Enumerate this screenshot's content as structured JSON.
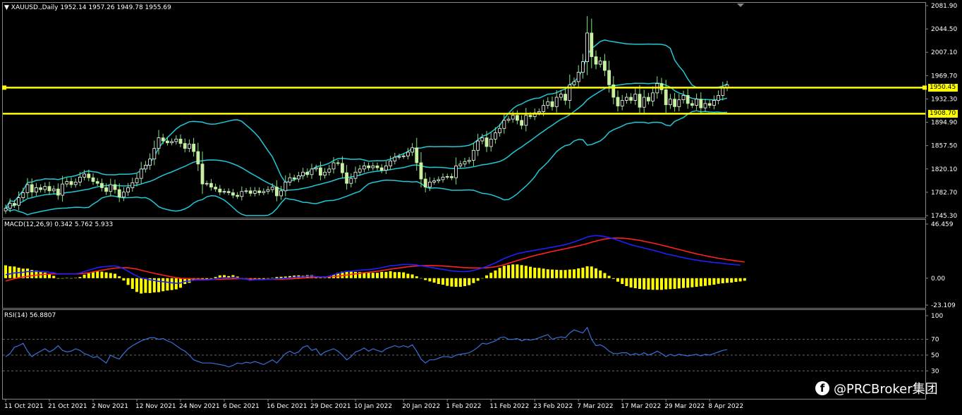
{
  "symbol_header": "XAUUSD.,Daily",
  "ohlc_header": "1952.14 1957.26 1949.78 1955.69",
  "macd_header": "MACD(12,26,9) 0.342 5.762 5.933",
  "rsi_header": "RSI(14) 56.8807",
  "watermark": "@PRCBroker集团",
  "watermark_icon": "facebook-icon",
  "colors": {
    "background": "#000000",
    "bull_candle": "#ffffff",
    "bear_candle": "#c8f0a0",
    "wick": "#7fe87f",
    "bollinger": "#20c8d8",
    "horizontal_levels": "#ffff00",
    "macd_line": "#2020ff",
    "signal_line": "#ff2020",
    "histogram": "#ffff00",
    "rsi_line": "#3a6fd8",
    "grid": "#444444"
  },
  "price_boxes": [
    {
      "label": "1950.45"
    },
    {
      "label": "1908.70"
    }
  ],
  "chart_data": [
    {
      "type": "candlestick",
      "panel": "price",
      "symbol": "XAUUSD.",
      "timeframe": "Daily",
      "ylim": [
        1745.3,
        2081.9
      ],
      "y_ticks": [
        "2081.90",
        "2044.50",
        "2007.10",
        "1969.70",
        "1932.30",
        "1894.90",
        "1857.50",
        "1820.10",
        "1782.70",
        "1745.30"
      ],
      "x_ticks": [
        "11 Oct 2021",
        "21 Oct 2021",
        "2 Nov 2021",
        "12 Nov 2021",
        "24 Nov 2021",
        "6 Dec 2021",
        "16 Dec 2021",
        "29 Dec 2021",
        "10 Jan 2022",
        "20 Jan 2022",
        "1 Feb 2022",
        "11 Feb 2022",
        "23 Feb 2022",
        "7 Mar 2022",
        "17 Mar 2022",
        "29 Mar 2022",
        "8 Apr 2022"
      ],
      "horizontal_levels": [
        1950.45,
        1908.7
      ],
      "close": [
        1757,
        1765,
        1762,
        1774,
        1782,
        1795,
        1783,
        1790,
        1787,
        1792,
        1785,
        1788,
        1778,
        1796,
        1800,
        1795,
        1799,
        1807,
        1812,
        1806,
        1800,
        1797,
        1790,
        1784,
        1795,
        1787,
        1775,
        1783,
        1790,
        1798,
        1805,
        1820,
        1826,
        1836,
        1853,
        1870,
        1865,
        1862,
        1864,
        1868,
        1861,
        1853,
        1860,
        1848,
        1828,
        1796,
        1797,
        1791,
        1788,
        1783,
        1784,
        1782,
        1778,
        1776,
        1784,
        1785,
        1781,
        1785,
        1782,
        1784,
        1787,
        1791,
        1777,
        1785,
        1799,
        1806,
        1804,
        1809,
        1815,
        1811,
        1820,
        1822,
        1810,
        1815,
        1820,
        1830,
        1829,
        1814,
        1797,
        1805,
        1815,
        1820,
        1825,
        1822,
        1825,
        1822,
        1818,
        1825,
        1833,
        1839,
        1840,
        1841,
        1847,
        1854,
        1830,
        1804,
        1791,
        1799,
        1801,
        1803,
        1807,
        1808,
        1806,
        1825,
        1828,
        1832,
        1834,
        1850,
        1865,
        1870,
        1856,
        1868,
        1878,
        1885,
        1898,
        1900,
        1906,
        1898,
        1890,
        1906,
        1904,
        1910,
        1912,
        1922,
        1928,
        1920,
        1935,
        1940,
        1930,
        1955,
        1960,
        1975,
        1992,
        2038,
        2000,
        1988,
        1993,
        1978,
        1955,
        1935,
        1921,
        1930,
        1935,
        1930,
        1940,
        1919,
        1935,
        1929,
        1942,
        1957,
        1947,
        1923,
        1932,
        1920,
        1931,
        1938,
        1925,
        1922,
        1932,
        1918,
        1925,
        1922,
        1930,
        1938,
        1950,
        1955
      ]
    },
    {
      "type": "line+bar",
      "panel": "macd",
      "title": "MACD(12,26,9)",
      "values_header": [
        0.342,
        5.762,
        5.933
      ],
      "ylim": [
        -23.109,
        46.459
      ],
      "y_ticks": [
        "46.459",
        "0.00",
        "-23.109"
      ],
      "series": [
        {
          "name": "MACD",
          "values": [
            9.5,
            10.2,
            11.0,
            11.3,
            11.6,
            12.2,
            12.1,
            12.4,
            12.2,
            12.2,
            11.6,
            11.2,
            10.0,
            10.1,
            10.3,
            10.2,
            10.3,
            10.9,
            12.2,
            13.3,
            14.5,
            15.6,
            16.2,
            16.5,
            16.8,
            17.0,
            16.2,
            14.5,
            12.5,
            10.3,
            8.4,
            6.7,
            6.1,
            5.1,
            4.5,
            3.8,
            3.5,
            3.0,
            2.5,
            2.1,
            2.3,
            3.7,
            4.0,
            4.7,
            5.0,
            4.8,
            5.0,
            5.2,
            5.9,
            6.7,
            7.0,
            6.7,
            7.2,
            6.7,
            5.9,
            5.7,
            4.6,
            5.2,
            5.2,
            5.2,
            5.5,
            5.6,
            6.0,
            6.2,
            6.5,
            6.8,
            7.2,
            7.5,
            7.6,
            8.1,
            8.4,
            7.9,
            7.6,
            7.6,
            8.2,
            9.5,
            10.6,
            11.5,
            12.3,
            12.5,
            12.9,
            13.3,
            13.6,
            13.9,
            14.3,
            14.8,
            15.7,
            16.3,
            17.2,
            17.4,
            17.9,
            18.3,
            18.2,
            18.3,
            17.8,
            17.1,
            16.5,
            15.9,
            15.3,
            14.6,
            14.1,
            13.4,
            12.8,
            12.4,
            12.1,
            12.2,
            12.4,
            13.2,
            14.2,
            15.2,
            16.6,
            18.1,
            19.6,
            21.5,
            23.4,
            24.8,
            26.3,
            27.5,
            28.3,
            29.1,
            29.8,
            30.4,
            31.2,
            31.8,
            32.4,
            33.1,
            33.8,
            34.5,
            35.3,
            36.4,
            37.6,
            39.0,
            40.3,
            41.8,
            42.7,
            43.1,
            42.8,
            42.2,
            41.3,
            40.4,
            39.1,
            37.8,
            36.5,
            35.2,
            34.2,
            33.3,
            32.4,
            31.5,
            30.6,
            29.6,
            28.5,
            27.4,
            26.6,
            25.8,
            24.9,
            24.1,
            23.3,
            22.6,
            22.0,
            21.4,
            20.9,
            20.4,
            20.0,
            19.6,
            19.2,
            18.8,
            18.4,
            18.0,
            17.7
          ]
        },
        {
          "name": "Signal",
          "values": [
            4.0,
            5.1,
            6.0,
            6.8,
            7.5,
            8.1,
            8.6,
            9.1,
            9.5,
            9.8,
            10.0,
            10.2,
            10.2,
            10.2,
            10.2,
            10.2,
            10.2,
            10.4,
            10.7,
            11.2,
            11.9,
            12.6,
            13.4,
            14.0,
            14.6,
            15.1,
            15.4,
            15.5,
            15.4,
            14.9,
            14.3,
            13.3,
            12.4,
            11.5,
            10.6,
            9.8,
            9.1,
            8.3,
            7.6,
            6.9,
            6.4,
            6.2,
            6.0,
            5.8,
            5.7,
            5.6,
            5.5,
            5.4,
            5.4,
            5.5,
            5.7,
            5.8,
            5.9,
            6.0,
            6.0,
            5.9,
            5.7,
            5.6,
            5.5,
            5.5,
            5.5,
            5.5,
            5.5,
            5.6,
            5.8,
            5.9,
            6.1,
            6.3,
            6.6,
            6.8,
            7.1,
            7.3,
            7.4,
            7.5,
            7.6,
            7.9,
            8.3,
            8.7,
            9.2,
            9.7,
            10.2,
            10.7,
            11.2,
            11.6,
            12.0,
            12.5,
            13.0,
            13.6,
            14.2,
            14.8,
            15.3,
            15.8,
            16.3,
            16.7,
            17.0,
            17.2,
            17.3,
            17.3,
            17.2,
            17.1,
            16.9,
            16.7,
            16.4,
            16.1,
            15.8,
            15.6,
            15.4,
            15.3,
            15.3,
            15.3,
            15.4,
            15.8,
            16.3,
            17.1,
            18.1,
            19.2,
            20.4,
            21.6,
            22.7,
            23.8,
            24.9,
            25.9,
            26.8,
            27.7,
            28.6,
            29.4,
            30.2,
            31.0,
            31.8,
            32.6,
            33.4,
            34.3,
            35.2,
            36.2,
            37.3,
            38.3,
            39.3,
            40.1,
            40.6,
            40.9,
            40.9,
            40.8,
            40.5,
            40.1,
            39.5,
            38.9,
            38.2,
            37.4,
            36.6,
            35.8,
            34.9,
            34.0,
            33.0,
            32.1,
            31.1,
            30.2,
            29.2,
            28.3,
            27.4,
            26.6,
            25.8,
            25.0,
            24.3,
            23.6,
            23.0,
            22.4,
            21.9,
            21.4,
            20.9,
            20.4
          ]
        },
        {
          "name": "Histogram",
          "values": [
            5.5,
            5.1,
            5.0,
            4.5,
            4.1,
            4.1,
            3.5,
            3.3,
            2.7,
            2.4,
            1.6,
            1.0,
            -0.2,
            -0.1,
            0.1,
            0.0,
            0.1,
            0.5,
            1.5,
            2.1,
            2.6,
            3.0,
            2.8,
            2.5,
            2.2,
            1.9,
            0.8,
            -1.0,
            -2.9,
            -4.6,
            -5.9,
            -6.6,
            -6.3,
            -6.4,
            -6.1,
            -6.0,
            -5.6,
            -5.3,
            -5.1,
            -4.8,
            -4.1,
            -2.5,
            -2.0,
            -1.1,
            -0.7,
            -0.8,
            -0.5,
            -0.2,
            0.5,
            1.2,
            1.3,
            0.9,
            1.3,
            0.7,
            -0.1,
            -0.2,
            -1.1,
            -0.4,
            -0.3,
            -0.3,
            0.0,
            0.1,
            0.5,
            0.6,
            0.7,
            0.9,
            1.1,
            1.2,
            1.0,
            1.3,
            1.3,
            0.6,
            0.2,
            0.1,
            0.6,
            1.6,
            2.3,
            2.8,
            3.1,
            2.8,
            2.7,
            2.6,
            2.4,
            2.3,
            2.3,
            2.3,
            2.7,
            2.7,
            3.0,
            2.6,
            2.6,
            2.5,
            1.9,
            1.6,
            0.8,
            -0.1,
            -0.8,
            -1.4,
            -1.9,
            -2.5,
            -2.8,
            -3.3,
            -3.6,
            -3.7,
            -3.7,
            -3.4,
            -3.0,
            -2.1,
            -1.1,
            -0.1,
            1.2,
            2.3,
            3.3,
            4.4,
            5.3,
            5.6,
            5.9,
            5.9,
            5.6,
            5.3,
            4.9,
            4.5,
            4.4,
            4.1,
            3.8,
            3.7,
            3.6,
            3.5,
            3.5,
            3.7,
            3.8,
            4.2,
            4.5,
            5.1,
            5.0,
            4.2,
            3.3,
            2.2,
            1.0,
            -0.3,
            -1.5,
            -2.5,
            -3.4,
            -4.0,
            -4.3,
            -4.6,
            -4.8,
            -4.9,
            -5.0,
            -5.0,
            -5.0,
            -4.8,
            -4.7,
            -4.6,
            -4.4,
            -4.2,
            -4.1,
            -3.9,
            -3.7,
            -3.5,
            -3.3,
            -3.0,
            -2.8,
            -2.4,
            -2.2,
            -2.0,
            -1.9,
            -1.6,
            -1.4,
            -1.1
          ]
        }
      ]
    },
    {
      "type": "line",
      "panel": "rsi",
      "title": "RSI(14)",
      "value_header": 56.8807,
      "ylim": [
        0,
        100
      ],
      "y_ticks": [
        "100",
        "70",
        "50",
        "30"
      ],
      "levels": [
        70,
        50,
        30
      ],
      "values": [
        48,
        52,
        60,
        62,
        65,
        55,
        48,
        52,
        55,
        58,
        54,
        57,
        62,
        56,
        54,
        55,
        58,
        56,
        52,
        50,
        47,
        48,
        44,
        40,
        50,
        47,
        45,
        52,
        58,
        62,
        65,
        68,
        70,
        72,
        72,
        70,
        71,
        68,
        66,
        62,
        58,
        55,
        50,
        44,
        42,
        40,
        40,
        40,
        39,
        38,
        37,
        35,
        37,
        40,
        39,
        41,
        40,
        42,
        40,
        38,
        41,
        44,
        40,
        46,
        52,
        55,
        52,
        54,
        60,
        62,
        56,
        58,
        50,
        54,
        56,
        58,
        55,
        50,
        44,
        48,
        54,
        56,
        59,
        55,
        58,
        56,
        54,
        58,
        60,
        62,
        60,
        62,
        60,
        63,
        55,
        45,
        40,
        44,
        44,
        46,
        48,
        48,
        47,
        50,
        51,
        52,
        53,
        56,
        60,
        65,
        64,
        66,
        68,
        72,
        73,
        70,
        70,
        71,
        68,
        70,
        69,
        70,
        72,
        74,
        76,
        70,
        72,
        73,
        72,
        78,
        82,
        80,
        78,
        85,
        70,
        62,
        63,
        60,
        55,
        52,
        52,
        53,
        53,
        50,
        52,
        50,
        53,
        50,
        52,
        55,
        52,
        48,
        51,
        49,
        51,
        50,
        49,
        50,
        51,
        49,
        51,
        50,
        52,
        54,
        56,
        57
      ]
    }
  ]
}
